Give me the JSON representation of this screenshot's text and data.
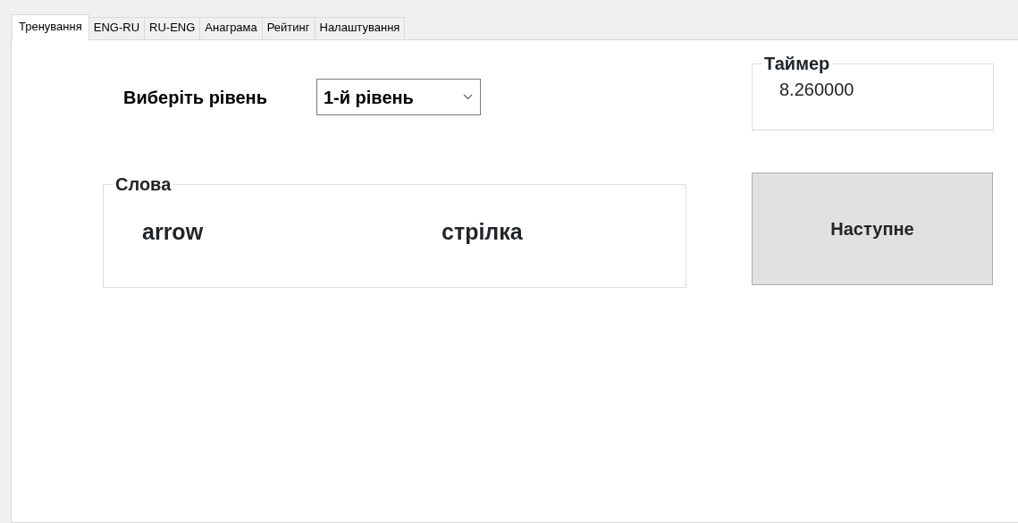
{
  "tabs": [
    {
      "label": "Тренування",
      "selected": true
    },
    {
      "label": "ENG-RU",
      "selected": false
    },
    {
      "label": "RU-ENG",
      "selected": false
    },
    {
      "label": "Анаграма",
      "selected": false
    },
    {
      "label": "Рейтинг",
      "selected": false
    },
    {
      "label": "Налаштування",
      "selected": false
    }
  ],
  "level": {
    "label": "Виберіть рівень",
    "value": "1-й рівень"
  },
  "words_group": {
    "title": "Слова",
    "words": [
      "arrow",
      "стрілка"
    ]
  },
  "timer": {
    "title": "Таймер",
    "value": "8.260000"
  },
  "next_button": {
    "label": "Наступне"
  }
}
